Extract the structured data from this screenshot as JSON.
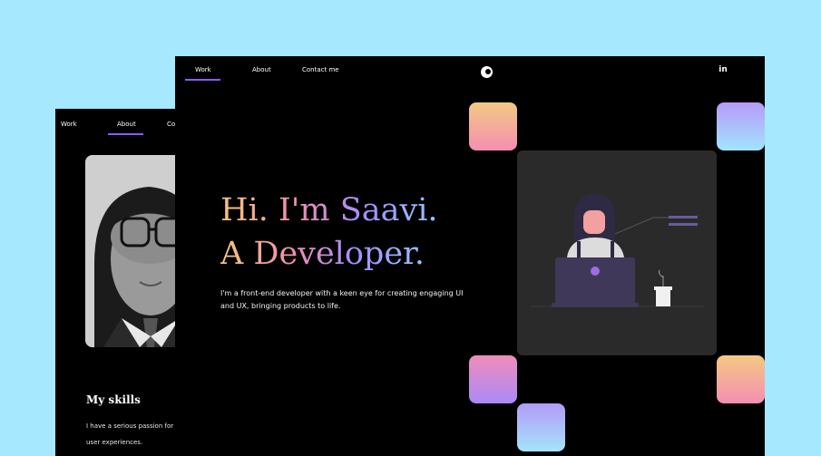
{
  "back_window": {
    "nav": {
      "work": "Work",
      "about": "About",
      "contact": "Co"
    },
    "skills": {
      "title": "My skills",
      "line1": "I have a serious passion for UI",
      "line2": "user experiences."
    }
  },
  "front_window": {
    "nav": {
      "work": "Work",
      "about": "About",
      "contact": "Contact me"
    },
    "social_icon": "linkedin-icon",
    "social_text": "in",
    "hero": {
      "line1": "Hi. I'm Saavi.",
      "line2": "A Developer.",
      "desc1": "I'm a front-end developer with a keen eye for creating engaging UI",
      "desc2": "and UX, bringing products to life."
    }
  },
  "colors": {
    "page_bg": "#a6e8fe",
    "window_bg": "#000000",
    "accent": "#8b5cf6",
    "card_bg": "#2a2a2a"
  }
}
